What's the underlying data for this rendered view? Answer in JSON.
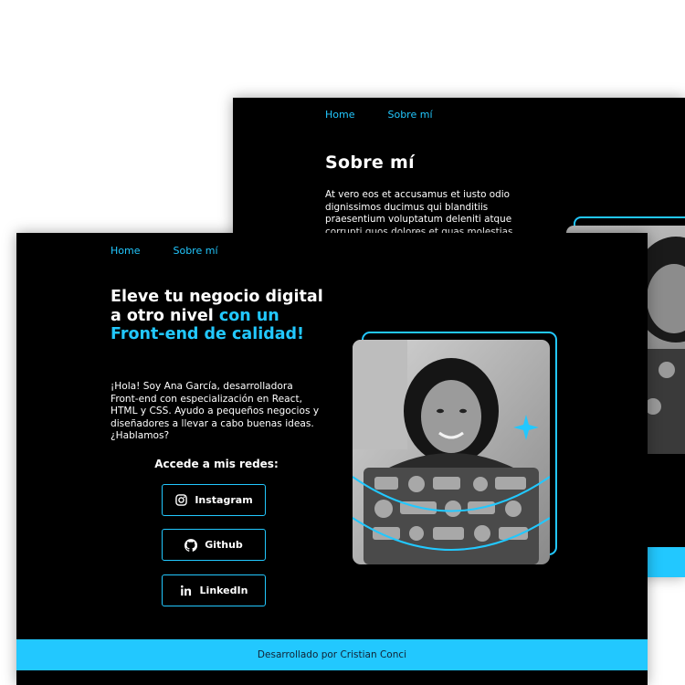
{
  "back_page": {
    "nav": {
      "home": "Home",
      "about": "Sobre mí"
    },
    "title": "Sobre mí",
    "paragraph": "At vero eos et accusamus et iusto odio dignissimos ducimus qui blanditiis praesentium voluptatum deleniti atque corrupti quos dolores et quas molestias"
  },
  "front_page": {
    "nav": {
      "home": "Home",
      "about": "Sobre mí"
    },
    "headline": {
      "line1": "Eleve tu negocio digital a otro nivel ",
      "accent": "con un Front-end de calidad!"
    },
    "intro": "¡Hola! Soy Ana García, desarrolladora Front-end con especialización en React, HTML y CSS. Ayudo a pequeños negocios y diseñadores a llevar a cabo buenas ideas. ¿Hablamos?",
    "socials": {
      "title": "Accede a mis redes:",
      "instagram": "Instagram",
      "github": "Github",
      "linkedin": "LinkedIn"
    },
    "footer": "Desarrollado por Cristian Conci"
  },
  "theme": {
    "accent": "#22c8ff",
    "background": "#000000",
    "text": "#ffffff"
  }
}
